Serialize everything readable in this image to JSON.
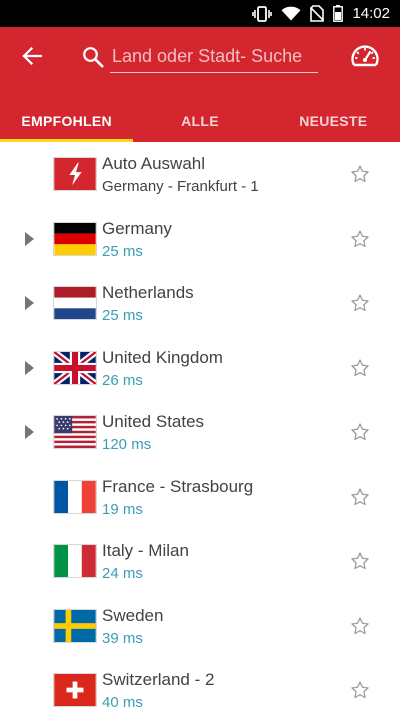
{
  "status_bar": {
    "time": "14:02",
    "icons": [
      "vibrate-icon",
      "wifi-icon",
      "no-sim-icon",
      "battery-icon"
    ]
  },
  "app_bar": {
    "back_icon": "arrow-back-icon",
    "search": {
      "placeholder": "Land oder Stadt- Suche",
      "value": ""
    },
    "speed_icon": "speedometer-icon",
    "colors": {
      "primary": "#d3262f",
      "tab_indicator": "#ffd91a"
    }
  },
  "tabs": [
    {
      "label": "EMPFOHLEN",
      "active": true
    },
    {
      "label": "ALLE",
      "active": false
    },
    {
      "label": "NEUESTE",
      "active": false
    }
  ],
  "servers": [
    {
      "name": "Auto Auswahl",
      "detail": "Germany - Frankfurt - 1",
      "flag": "auto",
      "expandable": false
    },
    {
      "name": "Germany",
      "detail": "25 ms",
      "flag": "de",
      "expandable": true
    },
    {
      "name": "Netherlands",
      "detail": "25 ms",
      "flag": "nl",
      "expandable": true
    },
    {
      "name": "United Kingdom",
      "detail": "26 ms",
      "flag": "gb",
      "expandable": true
    },
    {
      "name": "United States",
      "detail": "120 ms",
      "flag": "us",
      "expandable": true
    },
    {
      "name": "France - Strasbourg",
      "detail": "19 ms",
      "flag": "fr",
      "expandable": false
    },
    {
      "name": "Italy - Milan",
      "detail": "24 ms",
      "flag": "it",
      "expandable": false
    },
    {
      "name": "Sweden",
      "detail": "39 ms",
      "flag": "se",
      "expandable": false
    },
    {
      "name": "Switzerland - 2",
      "detail": "40 ms",
      "flag": "ch",
      "expandable": false
    }
  ],
  "latency_color": "#3b9db4"
}
